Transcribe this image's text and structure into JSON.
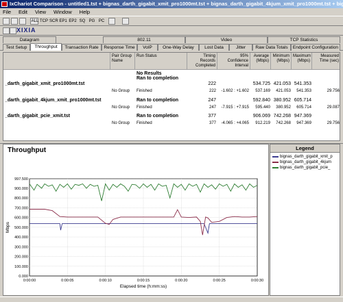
{
  "window": {
    "title": "IxChariot Comparison - untitled1.tst + bignas_darth_gigabit_xmit_pro1000mt.tst + bignas_darth_gigabit_4kjum_xmit_pro1000mt.tst + bignas..."
  },
  "menu": [
    "File",
    "Edit",
    "View",
    "Window",
    "Help"
  ],
  "toolbar": {
    "items": [
      "ALL",
      "TCP",
      "SCR",
      "EP1",
      "EP2",
      "SQ",
      "PG",
      "PC"
    ]
  },
  "brand": {
    "logo": "XIXIA"
  },
  "tab_groups": [
    "Datagram",
    "802.11",
    "Video",
    "TCP Statistics"
  ],
  "tabs": [
    "Test Setup",
    "Throughput",
    "Transaction Rate",
    "Response Time",
    "VoIP",
    "One-Way Delay",
    "Lost Data",
    "Jitter",
    "Raw Data Totals",
    "Endpoint Configuration"
  ],
  "active_tab": "Throughput",
  "grid": {
    "columns": [
      "Pair Group Name",
      "Run Status",
      "Timing Records Completed",
      "95% Confidence Interval",
      "Average (Mbps)",
      "Minimum (Mbps)",
      "Maximum (Mbps)",
      "Measured Time (sec)"
    ],
    "rows": [
      {
        "name": "",
        "group": "",
        "status": "No Results",
        "bold": true,
        "timing": "",
        "ci": "",
        "avg": "",
        "min": "",
        "max": "",
        "time": ""
      },
      {
        "name": "",
        "group": "",
        "status": "Ran to completion",
        "bold": true,
        "timing": "",
        "ci": "",
        "avg": "",
        "min": "",
        "max": "",
        "time": ""
      },
      {
        "name": "_darth_gigabit_xmit_pro1000mt.tst",
        "group": "",
        "status": "",
        "bold": true,
        "timing": "222",
        "ci": "",
        "avg": "534.725",
        "min": "421.053",
        "max": "541.353",
        "time": ""
      },
      {
        "name": "",
        "group": "No Group",
        "status": "Finished",
        "bold": false,
        "timing": "222",
        "ci": "-1.602 : +1.602",
        "avg": "537.169",
        "min": "421.053",
        "max": "541.353",
        "time": "29.756"
      },
      {
        "name": "_darth_gigabit_4kjum_xmit_pro1000mt.tst",
        "group": "",
        "status": "Ran to completion",
        "bold": true,
        "timing": "247",
        "ci": "",
        "avg": "592.840",
        "min": "380.952",
        "max": "605.714",
        "time": ""
      },
      {
        "name": "",
        "group": "No Group",
        "status": "Finished",
        "bold": false,
        "timing": "247",
        "ci": "-7.915 : +7.915",
        "avg": "595.440",
        "min": "380.952",
        "max": "605.714",
        "time": "29.087"
      },
      {
        "name": "_darth_gigabit_pcie_xmit.tst",
        "group": "",
        "status": "Ran to completion",
        "bold": true,
        "timing": "377",
        "ci": "",
        "avg": "906.069",
        "min": "742.268",
        "max": "947.369",
        "time": ""
      },
      {
        "name": "",
        "group": "No Group",
        "status": "Finished",
        "bold": false,
        "timing": "377",
        "ci": "-4.065 : +4.065",
        "avg": "912.219",
        "min": "742.268",
        "max": "947.369",
        "time": "29.756"
      }
    ]
  },
  "legend": {
    "title": "Legend",
    "items": [
      {
        "label": "bignas_darth_gigabit_xmit_p",
        "color": "#3b3b8f"
      },
      {
        "label": "bignas_darth_gigabit_4kjum",
        "color": "#8b2d4a"
      },
      {
        "label": "bignas_darth_gigabit_pcie_",
        "color": "#2e7d32"
      }
    ]
  },
  "chart_data": {
    "type": "line",
    "title": "Throughput",
    "xlabel": "Elapsed time (h:mm:ss)",
    "ylabel": "Mbps",
    "xticks": [
      "0:00:00",
      "0:00:05",
      "0:00:10",
      "0:00:15",
      "0:00:20",
      "0:00:25",
      "0:00:30"
    ],
    "yticks": [
      "0.000",
      "100.000",
      "200.000",
      "300.000",
      "400.000",
      "500.000",
      "600.000",
      "700.000",
      "800.000",
      "900.000",
      "997.500"
    ],
    "xlim": [
      0,
      30
    ],
    "ylim": [
      0,
      997.5
    ],
    "grid": true,
    "series": [
      {
        "name": "bignas_darth_gigabit_xmit_p",
        "color": "#3b3b8f",
        "x": [
          0,
          4,
          4.1,
          4.3,
          4.5,
          10,
          15,
          20,
          23,
          23.5,
          23.7,
          24,
          26,
          30
        ],
        "y": [
          537,
          537,
          470,
          537,
          537,
          537,
          537,
          537,
          537,
          440,
          537,
          537,
          537,
          537
        ]
      },
      {
        "name": "bignas_darth_gigabit_4kjum",
        "color": "#8b2d4a",
        "x": [
          0,
          2,
          3,
          4,
          5,
          6,
          7,
          8,
          9,
          10,
          10.5,
          11,
          12,
          13,
          14,
          15,
          16,
          17,
          18,
          19,
          19.5,
          20,
          21,
          22,
          22.5,
          22.8,
          23.2,
          23.5,
          24,
          25,
          26,
          27,
          28,
          29,
          30
        ],
        "y": [
          685,
          685,
          670,
          610,
          605,
          605,
          605,
          605,
          605,
          540,
          530,
          580,
          605,
          605,
          605,
          605,
          605,
          605,
          605,
          605,
          680,
          605,
          600,
          605,
          560,
          420,
          605,
          595,
          550,
          560,
          600,
          610,
          605,
          605,
          610
        ]
      },
      {
        "name": "bignas_darth_gigabit_pcie_",
        "color": "#2e7d32",
        "x": [
          0,
          0.6,
          1,
          1.6,
          2,
          2.5,
          3,
          3.5,
          4,
          4.5,
          5,
          5.5,
          6,
          6.5,
          7,
          7.5,
          8,
          8.5,
          9,
          9.5,
          10,
          10.5,
          11,
          11.5,
          12,
          12.5,
          13,
          13.5,
          14,
          14.5,
          15,
          15.5,
          16,
          16.5,
          17,
          17.5,
          18,
          18.5,
          19,
          19.5,
          20,
          20.5,
          21,
          21.5,
          22,
          22.5,
          23,
          23.5,
          24,
          24.5,
          25,
          25.5,
          26,
          26.5,
          27,
          27.5,
          28,
          28.5,
          29,
          29.5,
          30
        ],
        "y": [
          945,
          880,
          940,
          900,
          945,
          920,
          935,
          870,
          940,
          910,
          945,
          890,
          940,
          930,
          945,
          900,
          940,
          920,
          930,
          770,
          945,
          880,
          940,
          910,
          945,
          920,
          870,
          940,
          935,
          900,
          945,
          910,
          940,
          880,
          945,
          920,
          930,
          800,
          945,
          910,
          940,
          880,
          945,
          920,
          940,
          860,
          945,
          910,
          935,
          890,
          945,
          920,
          940,
          870,
          945,
          910,
          935,
          880,
          945,
          910,
          930
        ]
      }
    ]
  }
}
